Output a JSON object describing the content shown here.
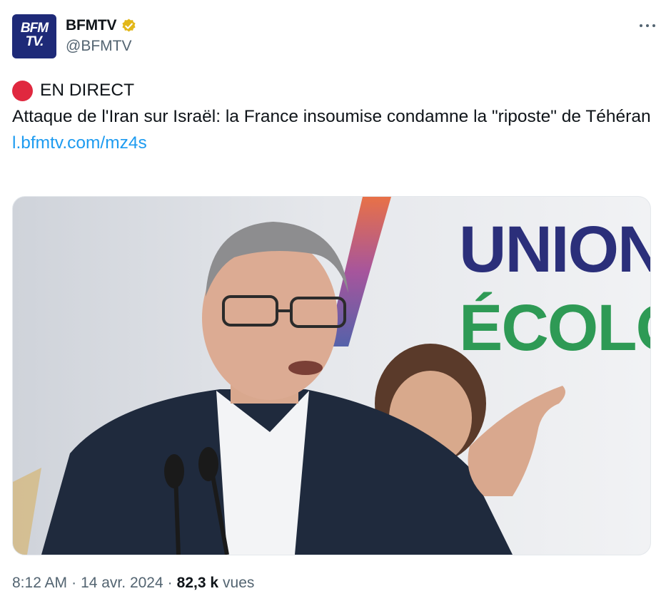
{
  "account": {
    "avatar_text": "BFM\nTV.",
    "display_name": "BFMTV",
    "handle": "@BFMTV",
    "verified": "verified-gold-badge",
    "avatar_color": "#1e2a78"
  },
  "tweet": {
    "live_label": "EN DIRECT",
    "headline": "Attaque de l'Iran sur Israël: la France insoumise condamne la \"riposte\" de Téhéran",
    "link": "l.bfmtv.com/mz4s"
  },
  "media": {
    "banner_line1": "UNION",
    "banner_line2": "ÉCOLOG",
    "banner_color_1": "#2b2f7a",
    "banner_color_2": "#2e9a55"
  },
  "meta": {
    "time": "8:12 AM",
    "separator1": "·",
    "date": "14 avr. 2024",
    "separator2": "·",
    "views_count": "82,3 k",
    "views_label": "vues"
  },
  "colors": {
    "link": "#1d9bf0",
    "live_dot": "#e0283f",
    "secondary_text": "#536471"
  }
}
